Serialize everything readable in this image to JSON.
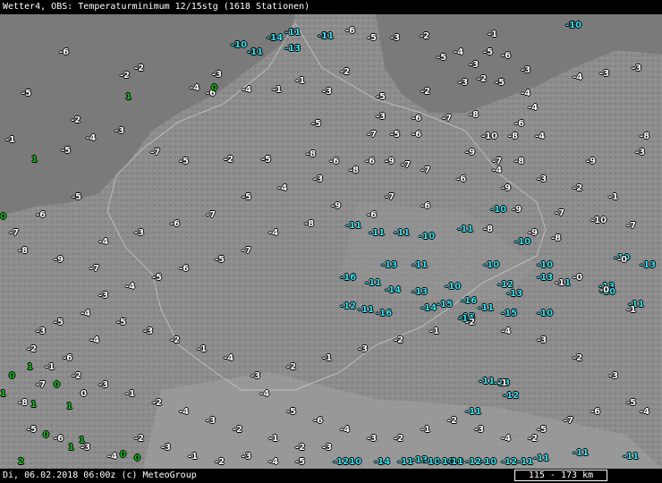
{
  "header": {
    "title": "Wetter4, OBS: Temperaturminimum 12/15stg (1618 Stationen)"
  },
  "footer": {
    "timestamp": "Di, 06.02.2018 06:00z (c) MeteoGroup",
    "scale": "115 - 173 km"
  },
  "colors": {
    "map_land": "#8a8a8a",
    "map_sea": "#7f7f7f",
    "value_default": "#ffffff",
    "value_cold": "#33e0f0",
    "value_positive": "#13c11a"
  },
  "observations": [
    {
      "v": "-5",
      "c": "white"
    },
    {
      "v": "-3",
      "c": "white"
    },
    {
      "v": "-4",
      "c": "white"
    },
    {
      "v": "-3",
      "c": "white"
    },
    {
      "v": "-2",
      "c": "white"
    },
    {
      "v": "-3",
      "c": "white"
    },
    {
      "v": "-4",
      "c": "white"
    },
    {
      "v": "-6",
      "c": "white"
    },
    {
      "v": "-5",
      "c": "white"
    },
    {
      "v": "-3",
      "c": "white"
    },
    {
      "v": "-2",
      "c": "white"
    },
    {
      "v": "-5",
      "c": "white"
    },
    {
      "v": "-4",
      "c": "white"
    },
    {
      "v": "-5",
      "c": "white"
    },
    {
      "v": "-6",
      "c": "white"
    },
    {
      "v": "-3",
      "c": "white"
    },
    {
      "v": "-2",
      "c": "white"
    },
    {
      "v": "-3",
      "c": "white"
    },
    {
      "v": "-1",
      "c": "white"
    },
    {
      "v": "-4",
      "c": "white"
    },
    {
      "v": "-4",
      "c": "white"
    },
    {
      "v": "-3",
      "c": "white"
    },
    {
      "v": "-3",
      "c": "white"
    },
    {
      "v": "-2",
      "c": "white"
    },
    {
      "v": "-2",
      "c": "white"
    },
    {
      "v": "-3",
      "c": "white"
    },
    {
      "v": "-6",
      "c": "white"
    },
    {
      "v": "-4",
      "c": "white"
    },
    {
      "v": "-1",
      "c": "white"
    },
    {
      "v": "-1",
      "c": "white"
    },
    {
      "v": "-2",
      "c": "white"
    },
    {
      "v": "-3",
      "c": "white"
    },
    {
      "v": "-5",
      "c": "white"
    },
    {
      "v": "-2",
      "c": "white"
    },
    {
      "v": "-3",
      "c": "white"
    },
    {
      "v": "-5",
      "c": "white"
    },
    {
      "v": "-4",
      "c": "white"
    },
    {
      "v": "-8",
      "c": "white"
    },
    {
      "v": "-7",
      "c": "white"
    },
    {
      "v": "-6",
      "c": "white"
    },
    {
      "v": "-3",
      "c": "white"
    },
    {
      "v": "-5",
      "c": "white"
    },
    {
      "v": "-7",
      "c": "white"
    },
    {
      "v": "-5",
      "c": "white"
    },
    {
      "v": "-6",
      "c": "white"
    },
    {
      "v": "-4",
      "c": "white"
    },
    {
      "v": "-6",
      "c": "white"
    },
    {
      "v": "-8",
      "c": "white"
    },
    {
      "v": "-3",
      "c": "white"
    },
    {
      "v": "-4",
      "c": "white"
    },
    {
      "v": "-5",
      "c": "white"
    },
    {
      "v": "-7",
      "c": "white"
    },
    {
      "v": "-5",
      "c": "white"
    },
    {
      "v": "-2",
      "c": "white"
    },
    {
      "v": "-5",
      "c": "white"
    },
    {
      "v": "-8",
      "c": "white"
    },
    {
      "v": "-6",
      "c": "white"
    },
    {
      "v": "-6",
      "c": "white"
    },
    {
      "v": "-7",
      "c": "white"
    },
    {
      "v": "-9",
      "c": "white"
    },
    {
      "v": "-7",
      "c": "white"
    },
    {
      "v": "-8",
      "c": "white"
    },
    {
      "v": "-9",
      "c": "white"
    },
    {
      "v": "-10",
      "c": "white"
    },
    {
      "v": "-8",
      "c": "white"
    },
    {
      "v": "-11",
      "c": "cyan"
    },
    {
      "v": "-11",
      "c": "cyan"
    },
    {
      "v": "-11",
      "c": "cyan"
    },
    {
      "v": "-10",
      "c": "cyan"
    },
    {
      "v": "-11",
      "c": "cyan"
    },
    {
      "v": "-10",
      "c": "cyan"
    },
    {
      "v": "-10",
      "c": "cyan"
    },
    {
      "v": "-13",
      "c": "cyan"
    },
    {
      "v": "-11",
      "c": "cyan"
    },
    {
      "v": "-10",
      "c": "cyan"
    },
    {
      "v": "-11",
      "c": "cyan"
    },
    {
      "v": "-13",
      "c": "cyan"
    },
    {
      "v": "-10",
      "c": "cyan"
    },
    {
      "v": "-12",
      "c": "cyan"
    },
    {
      "v": "-13",
      "c": "cyan"
    },
    {
      "v": "-11",
      "c": "cyan"
    },
    {
      "v": "-13",
      "c": "cyan"
    },
    {
      "v": "-11",
      "c": "cyan"
    },
    {
      "v": "-16",
      "c": "cyan"
    },
    {
      "v": "-12",
      "c": "cyan"
    },
    {
      "v": "-14",
      "c": "cyan"
    },
    {
      "v": "-15",
      "c": "cyan"
    },
    {
      "v": "-16",
      "c": "cyan"
    },
    {
      "v": "-13",
      "c": "cyan"
    },
    {
      "v": "-11",
      "c": "cyan"
    },
    {
      "v": "-13",
      "c": "cyan"
    },
    {
      "v": "-14",
      "c": "cyan"
    },
    {
      "v": "-11",
      "c": "cyan"
    },
    {
      "v": "-13",
      "c": "cyan"
    },
    {
      "v": "-12",
      "c": "cyan"
    },
    {
      "v": "-11",
      "c": "cyan"
    },
    {
      "v": "-10",
      "c": "cyan"
    },
    {
      "v": "-10",
      "c": "cyan"
    },
    {
      "v": "-11",
      "c": "cyan"
    },
    {
      "v": "-10",
      "c": "cyan"
    },
    {
      "v": "-10",
      "c": "cyan"
    },
    {
      "v": "-14",
      "c": "cyan"
    },
    {
      "v": "-16",
      "c": "cyan"
    },
    {
      "v": "-12",
      "c": "cyan"
    },
    {
      "v": "-11",
      "c": "cyan"
    },
    {
      "v": "-11",
      "c": "cyan"
    },
    {
      "v": "-11",
      "c": "cyan"
    },
    {
      "v": "-10",
      "c": "cyan"
    },
    {
      "v": "-11",
      "c": "cyan"
    },
    {
      "v": "-13",
      "c": "cyan"
    },
    {
      "v": "-11",
      "c": "cyan"
    },
    {
      "v": "-10",
      "c": "cyan"
    },
    {
      "v": "-14",
      "c": "cyan"
    },
    {
      "v": "-13",
      "c": "cyan"
    },
    {
      "v": "-12",
      "c": "cyan"
    },
    {
      "v": "-10",
      "c": "cyan"
    },
    {
      "v": "-10",
      "c": "cyan"
    },
    {
      "v": "-11",
      "c": "cyan"
    },
    {
      "v": "-15",
      "c": "cyan"
    },
    {
      "v": "-10",
      "c": "cyan"
    },
    {
      "v": "-9",
      "c": "white"
    },
    {
      "v": "-10",
      "c": "white"
    },
    {
      "v": "-7",
      "c": "white"
    },
    {
      "v": "-9",
      "c": "white"
    },
    {
      "v": "-8",
      "c": "white"
    },
    {
      "v": "-7",
      "c": "white"
    },
    {
      "v": "-9",
      "c": "white"
    },
    {
      "v": "-8",
      "c": "white"
    },
    {
      "v": "-6",
      "c": "white"
    },
    {
      "v": "-7",
      "c": "white"
    },
    {
      "v": "-6",
      "c": "white"
    },
    {
      "v": "-9",
      "c": "white"
    },
    {
      "v": "-8",
      "c": "white"
    },
    {
      "v": "-4",
      "c": "white"
    },
    {
      "v": "-7",
      "c": "white"
    },
    {
      "v": "-5",
      "c": "white"
    },
    {
      "v": "-6",
      "c": "white"
    },
    {
      "v": "-5",
      "c": "white"
    },
    {
      "v": "-4",
      "c": "white"
    },
    {
      "v": "-3",
      "c": "white"
    },
    {
      "v": "-4",
      "c": "white"
    },
    {
      "v": "-5",
      "c": "white"
    },
    {
      "v": "-3",
      "c": "white"
    },
    {
      "v": "-2",
      "c": "white"
    },
    {
      "v": "-1",
      "c": "white"
    },
    {
      "v": "-2",
      "c": "white"
    },
    {
      "v": "-3",
      "c": "white"
    },
    {
      "v": "-1",
      "c": "white"
    },
    {
      "v": "-2",
      "c": "white"
    },
    {
      "v": "-4",
      "c": "white"
    },
    {
      "v": "-3",
      "c": "white"
    },
    {
      "v": "-2",
      "c": "white"
    },
    {
      "v": "-1",
      "c": "white"
    },
    {
      "v": "-2",
      "c": "white"
    },
    {
      "v": "-3",
      "c": "white"
    },
    {
      "v": "-4",
      "c": "white"
    },
    {
      "v": "-5",
      "c": "white"
    },
    {
      "v": "-6",
      "c": "white"
    },
    {
      "v": "-4",
      "c": "white"
    },
    {
      "v": "-3",
      "c": "white"
    },
    {
      "v": "-2",
      "c": "white"
    },
    {
      "v": "-1",
      "c": "white"
    },
    {
      "v": "-2",
      "c": "white"
    },
    {
      "v": "-3",
      "c": "white"
    },
    {
      "v": "-4",
      "c": "white"
    },
    {
      "v": "-5",
      "c": "white"
    },
    {
      "v": "-7",
      "c": "white"
    },
    {
      "v": "-6",
      "c": "white"
    },
    {
      "v": "-5",
      "c": "white"
    },
    {
      "v": "-4",
      "c": "white"
    },
    {
      "v": "-3",
      "c": "white"
    },
    {
      "v": "-2",
      "c": "white"
    },
    {
      "v": "-3",
      "c": "white"
    },
    {
      "v": "-4",
      "c": "white"
    },
    {
      "v": "-2",
      "c": "white"
    },
    {
      "v": "-1",
      "c": "white"
    },
    {
      "v": "-2",
      "c": "white"
    },
    {
      "v": "-3",
      "c": "white"
    },
    {
      "v": "-1",
      "c": "white"
    },
    {
      "v": "-2",
      "c": "white"
    },
    {
      "v": "-3",
      "c": "white"
    },
    {
      "v": "-4",
      "c": "white"
    },
    {
      "v": "-1",
      "c": "white"
    },
    {
      "v": "-2",
      "c": "white"
    },
    {
      "v": "-3",
      "c": "white"
    },
    {
      "v": "-5",
      "c": "white"
    },
    {
      "v": "-4",
      "c": "white"
    },
    {
      "v": "-6",
      "c": "white"
    },
    {
      "v": "-7",
      "c": "white"
    },
    {
      "v": "-8",
      "c": "white"
    },
    {
      "v": "-5",
      "c": "white"
    },
    {
      "v": "-6",
      "c": "white"
    },
    {
      "v": "-3",
      "c": "white"
    },
    {
      "v": "-4",
      "c": "white"
    },
    {
      "v": "-2",
      "c": "white"
    },
    {
      "v": "-3",
      "c": "white"
    },
    {
      "v": "-1",
      "c": "white"
    },
    {
      "v": "-2",
      "c": "white"
    },
    {
      "v": "-3",
      "c": "white"
    },
    {
      "v": "-4",
      "c": "white"
    },
    {
      "v": "-5",
      "c": "white"
    },
    {
      "v": "-4",
      "c": "white"
    },
    {
      "v": "-3",
      "c": "white"
    },
    {
      "v": "-6",
      "c": "white"
    },
    {
      "v": "-7",
      "c": "white"
    },
    {
      "v": "-5",
      "c": "white"
    },
    {
      "v": "-4",
      "c": "white"
    },
    {
      "v": "-3",
      "c": "white"
    },
    {
      "v": "-8",
      "c": "white"
    },
    {
      "v": "-9",
      "c": "white"
    },
    {
      "v": "-7",
      "c": "white"
    },
    {
      "v": "-6",
      "c": "white"
    },
    {
      "v": "-4",
      "c": "white"
    },
    {
      "v": "-3",
      "c": "white"
    },
    {
      "v": "-2",
      "c": "white"
    },
    {
      "v": "-1",
      "c": "white"
    },
    {
      "v": "-3",
      "c": "white"
    },
    {
      "v": "-5",
      "c": "white"
    },
    {
      "v": "-6",
      "c": "white"
    },
    {
      "v": "-7",
      "c": "white"
    },
    {
      "v": "-8",
      "c": "white"
    },
    {
      "v": "-9",
      "c": "white"
    },
    {
      "v": "-7",
      "c": "white"
    },
    {
      "v": "-6",
      "c": "white"
    },
    {
      "v": "-5",
      "c": "white"
    },
    {
      "v": "-4",
      "c": "white"
    },
    {
      "v": "-2",
      "c": "white"
    },
    {
      "v": "-1",
      "c": "white"
    },
    {
      "v": "1",
      "c": "green"
    },
    {
      "v": "1",
      "c": "green"
    },
    {
      "v": "0",
      "c": "green"
    },
    {
      "v": "1",
      "c": "green"
    },
    {
      "v": "2",
      "c": "green"
    },
    {
      "v": "0",
      "c": "green"
    },
    {
      "v": "0",
      "c": "green"
    },
    {
      "v": "1",
      "c": "green"
    },
    {
      "v": "1",
      "c": "green"
    },
    {
      "v": "0",
      "c": "green"
    },
    {
      "v": "1",
      "c": "green"
    },
    {
      "v": "0",
      "c": "green"
    },
    {
      "v": "1",
      "c": "green"
    },
    {
      "v": "0",
      "c": "green"
    },
    {
      "v": "1",
      "c": "green"
    },
    {
      "v": "0",
      "c": "green"
    },
    {
      "v": "0",
      "c": "white"
    },
    {
      "v": "-0",
      "c": "white"
    },
    {
      "v": "-1",
      "c": "white"
    },
    {
      "v": "-0",
      "c": "white"
    },
    {
      "v": "-1",
      "c": "white"
    },
    {
      "v": "-0",
      "c": "white"
    },
    {
      "v": "-1",
      "c": "white"
    },
    {
      "v": "-2",
      "c": "white"
    },
    {
      "v": "-12",
      "c": "cyan"
    },
    {
      "v": "-10",
      "c": "cyan"
    },
    {
      "v": "-14",
      "c": "cyan"
    },
    {
      "v": "-11",
      "c": "cyan"
    },
    {
      "v": "-11",
      "c": "cyan"
    },
    {
      "v": "-10",
      "c": "cyan"
    },
    {
      "v": "-11",
      "c": "cyan"
    },
    {
      "v": "-13",
      "c": "cyan"
    }
  ]
}
